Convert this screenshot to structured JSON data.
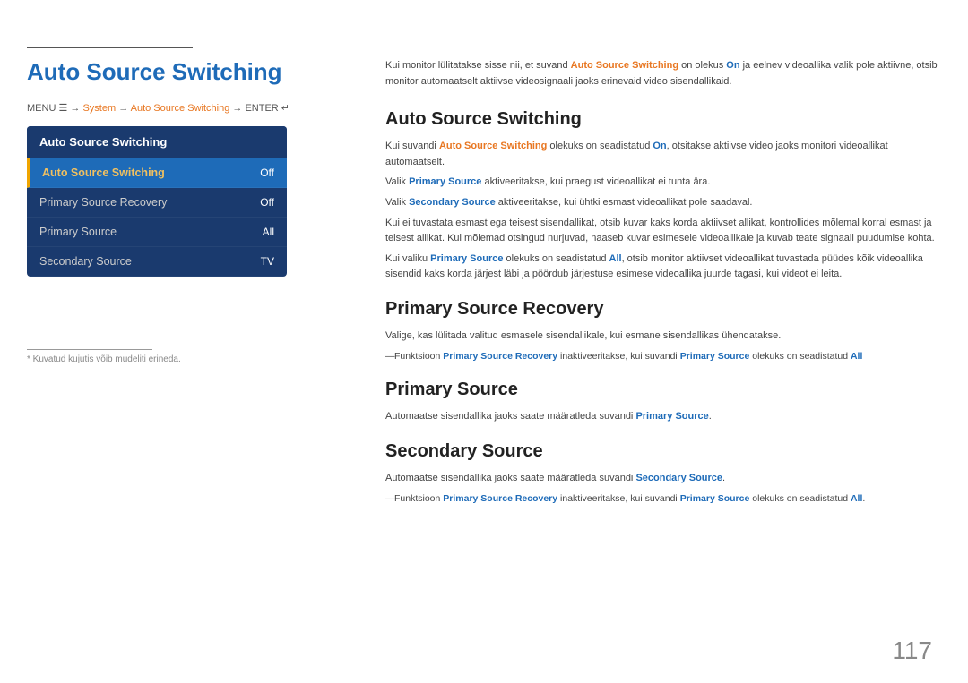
{
  "page": {
    "number": "117",
    "top_accent_line": true
  },
  "left": {
    "title": "Auto Source Switching",
    "menu_path": {
      "prefix": "MENU",
      "menu_icon": "☰",
      "system": "System",
      "arrow1": "→",
      "highlight": "Auto Source Switching",
      "arrow2": "→",
      "enter": "ENTER",
      "enter_icon": "↵"
    },
    "ui_box": {
      "header": "Auto Source Switching",
      "rows": [
        {
          "label": "Auto Source Switching",
          "value": "Off",
          "active": true
        },
        {
          "label": "Primary Source Recovery",
          "value": "Off",
          "active": false
        },
        {
          "label": "Primary Source",
          "value": "All",
          "active": false
        },
        {
          "label": "Secondary Source",
          "value": "TV",
          "active": false
        }
      ]
    },
    "footnote": "* Kuvatud kujutis võib mudeliti erineda."
  },
  "right": {
    "intro": {
      "text_before": "Kui monitor lülitatakse sisse nii, et suvand ",
      "bold1": "Auto Source Switching",
      "text_mid": " on olekus ",
      "bold2": "On",
      "text_after": " ja eelnev videoallika valik pole aktiivne, otsib monitor automaatselt aktiivse videosignaali jaoks erinevaid video sisendallikaid."
    },
    "sections": [
      {
        "id": "auto-source-switching",
        "title": "Auto Source Switching",
        "paragraphs": [
          {
            "type": "body",
            "text": "Kui suvandi Auto Source Switching olekuks on seadistatud On, otsitakse aktiivse video jaoks monitori videoallikat automaatselt.",
            "bold_words": [
              "Auto Source Switching",
              "On"
            ]
          },
          {
            "type": "body",
            "text": "Valik Primary Source aktiveeritakse, kui praegust videoallikat ei tunta ära.",
            "bold_words": [
              "Primary Source"
            ]
          },
          {
            "type": "body",
            "text": "Valik Secondary Source aktiveeritakse, kui ühtki esmast videoallikat pole saadaval.",
            "bold_words": [
              "Secondary Source"
            ]
          },
          {
            "type": "body",
            "text": "Kui ei tuvastata esmast ega teisest sisendallikat, otsib kuvar kaks korda aktiivset allikat, kontrollides mõlemal korral esmast ja teisest allikat. Kui mõlemad otsingud nurjuvad, naaseb kuvar esimesele videoallikale ja kuvab teate signaali puudumise kohta."
          },
          {
            "type": "body",
            "text": "Kui valiku Primary Source olekuks on seadistatud All, otsib monitor aktiivset videoallikat tuvastada püüdes kõik videoallika sisendid kaks korda järjest läbi ja pöördub järjestuse esimese videoallika juurde tagasi, kui videot ei leita.",
            "bold_words": [
              "Primary Source",
              "All"
            ]
          }
        ]
      },
      {
        "id": "primary-source-recovery",
        "title": "Primary Source Recovery",
        "paragraphs": [
          {
            "type": "body",
            "text": "Valige, kas lülitada valitud esmasele sisendallikale, kui esmane sisendallikas ühendatakse."
          },
          {
            "type": "note",
            "text": "Funktsioon Primary Source Recovery inaktiveeritakse, kui suvandi Primary Source olekuks on seadistatud All",
            "bold_words": [
              "Primary Source Recovery",
              "Primary Source",
              "All"
            ]
          }
        ]
      },
      {
        "id": "primary-source",
        "title": "Primary Source",
        "paragraphs": [
          {
            "type": "body",
            "text": "Automaatse sisendallika jaoks saate määratleda suvandi Primary Source.",
            "bold_words": [
              "Primary Source"
            ]
          }
        ]
      },
      {
        "id": "secondary-source",
        "title": "Secondary Source",
        "paragraphs": [
          {
            "type": "body",
            "text": "Automaatse sisendallika jaoks saate määratleda suvandi Secondary Source.",
            "bold_words": [
              "Secondary Source"
            ]
          },
          {
            "type": "note",
            "text": "Funktsioon Primary Source Recovery inaktiveeritakse, kui suvandi Primary Source olekuks on seadistatud All.",
            "bold_words": [
              "Primary Source Recovery",
              "Primary Source",
              "All"
            ]
          }
        ]
      }
    ]
  }
}
